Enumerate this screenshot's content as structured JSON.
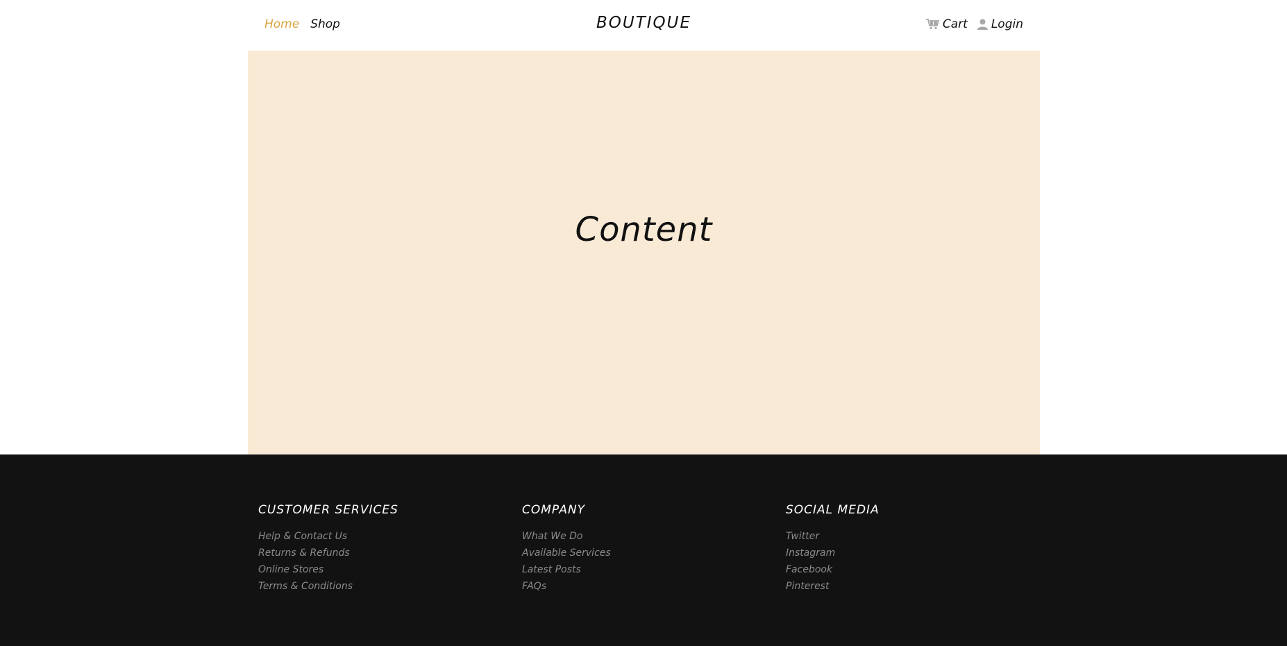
{
  "header": {
    "nav_left": [
      {
        "label": "Home",
        "active": true
      },
      {
        "label": "Shop",
        "active": false
      }
    ],
    "brand": "BOUTIQUE",
    "cart_label": "Cart",
    "login_label": "Login",
    "icons": {
      "cart": "cart-icon",
      "login": "user-icon"
    }
  },
  "main": {
    "title": "Content",
    "background": "#f9ead6"
  },
  "footer": {
    "background": "#121212",
    "columns": [
      {
        "title": "CUSTOMER SERVICES",
        "links": [
          "Help & Contact Us",
          "Returns & Refunds",
          "Online Stores",
          "Terms & Conditions"
        ]
      },
      {
        "title": "COMPANY",
        "links": [
          "What We Do",
          "Available Services",
          "Latest Posts",
          "FAQs"
        ]
      },
      {
        "title": "SOCIAL MEDIA",
        "links": [
          "Twitter",
          "Instagram",
          "Facebook",
          "Pinterest"
        ]
      }
    ]
  },
  "colors": {
    "accent": "#d9a43c",
    "text": "#111111",
    "footer_link": "#8b8b8b"
  }
}
